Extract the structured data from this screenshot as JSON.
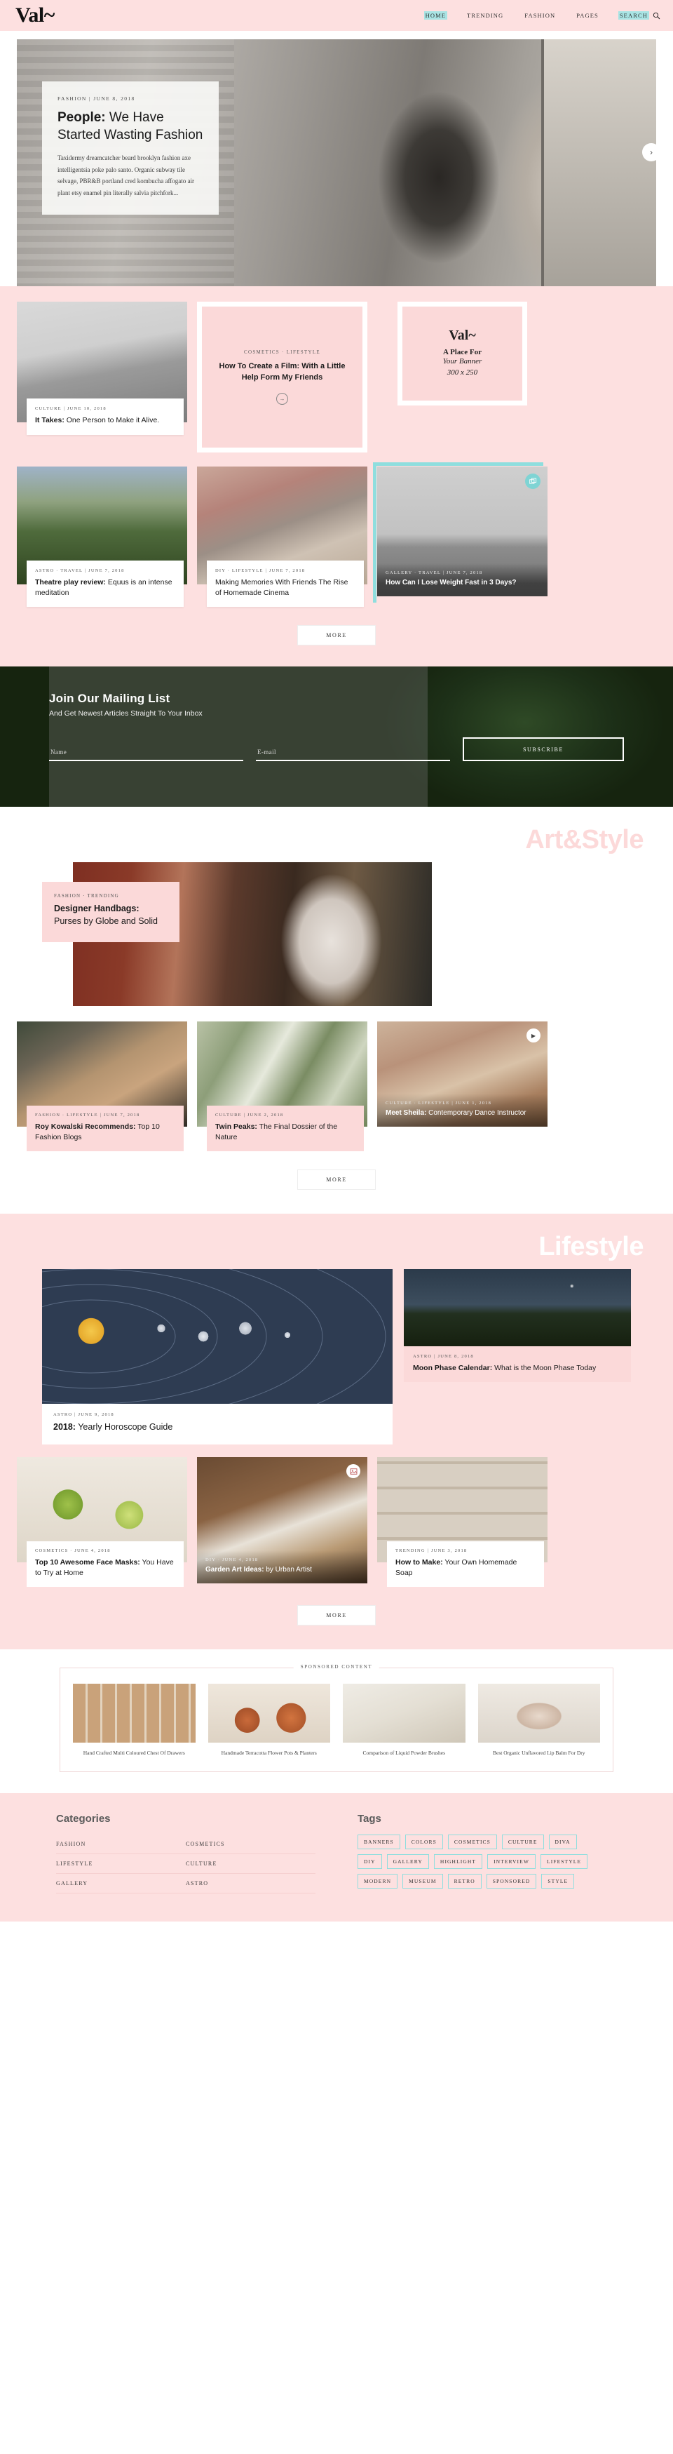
{
  "header": {
    "logo": "Val~",
    "nav": [
      {
        "label": "HOME",
        "highlight": true
      },
      {
        "label": "TRENDING",
        "highlight": false
      },
      {
        "label": "FASHION",
        "highlight": false
      },
      {
        "label": "PAGES",
        "highlight": false
      },
      {
        "label": "SEARCH",
        "highlight": true
      }
    ],
    "search_icon": "search-icon"
  },
  "hero": {
    "meta": "FASHION  |  JUNE 8, 2018",
    "title_bold": "People:",
    "title_rest": " We Have Started Wasting Fashion",
    "excerpt": "Taxidermy dreamcatcher beard brooklyn fashion axe intelligentsia poke palo santo. Organic subway tile selvage, PBR&B portland cred kombucha affogato air plant etsy enamel pin literally salvia pitchfork...",
    "arrow": "›"
  },
  "trending": {
    "card_left": {
      "meta": "CULTURE  |  JUNE 10, 2018",
      "title_bold": "It Takes:",
      "title_rest": " One Person to Make it Alive."
    },
    "promo": {
      "cats": "COSMETICS  ·  LIFESTYLE",
      "title": "How To Create a Film: With a Little Help Form My Friends",
      "arrow": "→"
    },
    "banner": {
      "logo": "Val~",
      "line1": "A Place For",
      "line2": "Your Banner",
      "line3": "300 x 250"
    },
    "card_a": {
      "meta": "ASTRO  ·  TRAVEL  |  JUNE 7, 2018",
      "title_bold": "Theatre play review:",
      "title_rest": " Equus is an intense meditation"
    },
    "card_b": {
      "meta": "DIY  ·  LIFESTYLE  |  JUNE 7, 2018",
      "title_bold": "",
      "title_rest": "Making Memories With Friends The Rise of Homemade Cinema"
    },
    "card_c": {
      "meta": "GALLERY  ·  TRAVEL  |  JUNE 7, 2018",
      "title_bold": "",
      "title_rest": "How Can I Lose Weight Fast in 3 Days?",
      "badge_icon": "gallery-icon"
    },
    "more_label": "MORE"
  },
  "newsletter": {
    "heading": "Join Our Mailing List",
    "subheading": "And Get Newest Articles Straight To Your Inbox",
    "name_placeholder": "Name",
    "email_placeholder": "E-mail",
    "button": "SUBSCRIBE"
  },
  "art": {
    "section_title": "Art&Style",
    "feature": {
      "meta": "FASHION  ·  TRENDING",
      "title_bold": "Designer Handbags:",
      "title_rest": " Purses by Globe and Solid"
    },
    "cards": [
      {
        "meta": "FASHION  ·  LIFESTYLE  |  JUNE 7, 2018",
        "title_bold": "Roy Kowalski Recommends:",
        "title_rest": " Top 10 Fashion Blogs"
      },
      {
        "meta": "CULTURE  |  JUNE 2, 2018",
        "title_bold": "Twin Peaks:",
        "title_rest": " The Final Dossier of the Nature"
      },
      {
        "meta": "CULTURE  ·  LIFESTYLE  |  JUNE 1, 2018",
        "title_bold": "Meet Sheila:",
        "title_rest": " Contemporary Dance Instructor",
        "badge_icon": "play-icon"
      }
    ],
    "more_label": "MORE"
  },
  "lifestyle": {
    "section_title": "Lifestyle",
    "big": {
      "meta": "ASTRO  |  JUNE 9, 2018",
      "title_bold": "2018:",
      "title_rest": " Yearly Horoscope Guide"
    },
    "side": {
      "meta": "ASTRO  |  JUNE 8, 2018",
      "title_bold": "Moon Phase Calendar:",
      "title_rest": " What is the Moon Phase Today"
    },
    "cards": [
      {
        "meta": "COSMETICS  ·  JUNE 4, 2018",
        "title_bold": "Top 10 Awesome Face Masks:",
        "title_rest": " You Have to Try at Home"
      },
      {
        "meta": "DIY  ·  JUNE 4, 2018",
        "title_bold": "Garden Art Ideas:",
        "title_rest": " by Urban Artist",
        "badge_icon": "picture-icon"
      },
      {
        "meta": "TRENDING  |  JUNE 3, 2018",
        "title_bold": "How to Make:",
        "title_rest": " Your Own Homemade Soap"
      }
    ],
    "more_label": "MORE"
  },
  "sponsored": {
    "heading": "SPONSORED CONTENT",
    "items": [
      {
        "title": "Hand Crafted Multi Coloured Chest Of Drawers"
      },
      {
        "title": "Handmade Terracotta Flower Pots & Planters"
      },
      {
        "title": "Comparison of Liquid Powder Brushes"
      },
      {
        "title": "Best Organic Unflavored Lip Balm For Dry"
      }
    ]
  },
  "footer": {
    "categories_heading": "Categories",
    "categories": [
      [
        "FASHION",
        "COSMETICS"
      ],
      [
        "LIFESTYLE",
        "CULTURE"
      ],
      [
        "GALLERY",
        "ASTRO"
      ]
    ],
    "tags_heading": "Tags",
    "tags": [
      "BANNERS",
      "COLORS",
      "COSMETICS",
      "CULTURE",
      "DIVA",
      "DIY",
      "GALLERY",
      "HIGHLIGHT",
      "INTERVIEW",
      "LIFESTYLE",
      "MODERN",
      "MUSEUM",
      "RETRO",
      "SPONSORED",
      "STYLE"
    ]
  },
  "colors": {
    "pink_bg": "#fde0e0",
    "pink_card": "#fbd9d9",
    "teal": "#8fdede",
    "dark": "#1b1b1b"
  }
}
